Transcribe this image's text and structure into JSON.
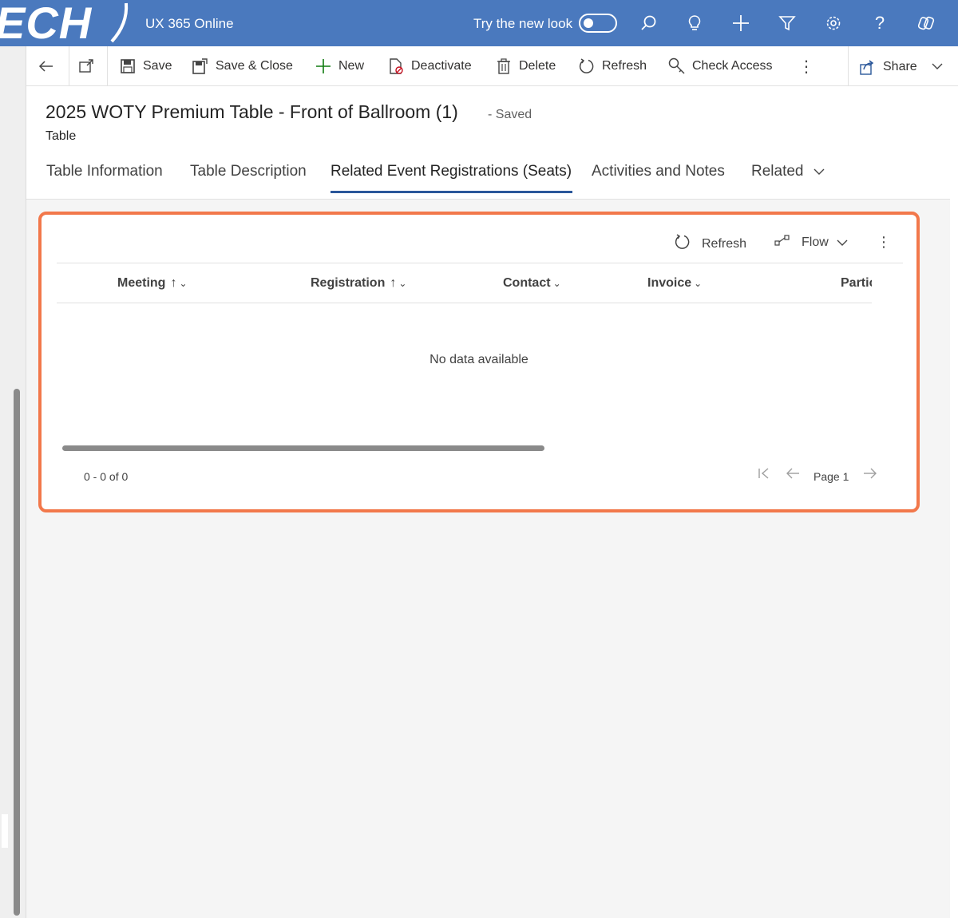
{
  "app": {
    "logo_text": "ECH",
    "title": "UX 365 Online",
    "new_look_label": "Try the new look",
    "new_look_on": false,
    "top_icons": [
      "search-icon",
      "lightbulb-icon",
      "plus-icon",
      "filter-icon",
      "settings-icon",
      "help-icon",
      "copilot-icon"
    ],
    "brand_color": "#4a79be"
  },
  "commandbar": {
    "save": "Save",
    "save_close": "Save & Close",
    "new": "New",
    "deactivate": "Deactivate",
    "delete": "Delete",
    "refresh": "Refresh",
    "check_access": "Check Access",
    "share": "Share"
  },
  "record": {
    "title": "2025 WOTY Premium Table - Front of Ballroom (1)",
    "save_status": "- Saved",
    "entity": "Table"
  },
  "tabs": [
    {
      "label": "Table Information",
      "active": false
    },
    {
      "label": "Table Description",
      "active": false
    },
    {
      "label": "Related Event Registrations (Seats)",
      "active": true
    },
    {
      "label": "Activities and Notes",
      "active": false
    },
    {
      "label": "Related",
      "active": false
    }
  ],
  "subgrid": {
    "refresh": "Refresh",
    "flow": "Flow",
    "columns": [
      {
        "label": "Meeting",
        "sorted": true
      },
      {
        "label": "Registration",
        "sorted": true
      },
      {
        "label": "Contact",
        "sorted": false
      },
      {
        "label": "Invoice",
        "sorted": false
      },
      {
        "label": "Partic",
        "sorted": false
      }
    ],
    "empty_message": "No data available",
    "record_count": "0 - 0 of 0",
    "page_label": "Page 1",
    "highlight_color": "#f2784b"
  }
}
